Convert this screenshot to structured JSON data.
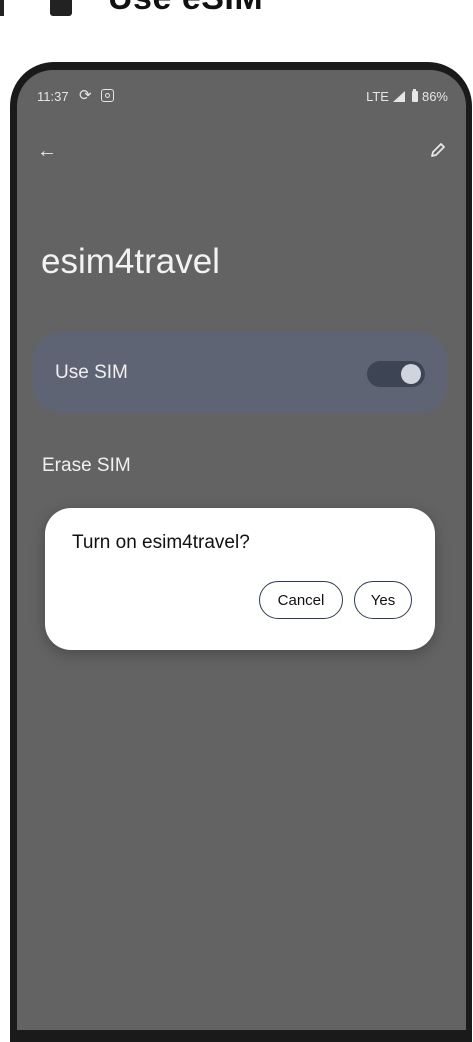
{
  "heading": {
    "text": "Use eSIM"
  },
  "status_bar": {
    "time": "11:37",
    "network": "LTE",
    "battery": "86%"
  },
  "page": {
    "title": "esim4travel"
  },
  "settings": {
    "use_sim": {
      "label": "Use SIM",
      "enabled": true
    },
    "erase_sim": {
      "label": "Erase SIM"
    }
  },
  "dialog": {
    "title": "Turn on esim4travel?",
    "cancel_label": "Cancel",
    "yes_label": "Yes"
  },
  "icons": {
    "sync": "sync-icon",
    "instagram": "instagram-icon",
    "signal": "signal-icon",
    "battery": "battery-icon",
    "back": "back-arrow-icon",
    "edit": "pencil-icon"
  },
  "colors": {
    "scrim": "#636363",
    "card": "#5f6475",
    "toggle_track": "#3d4555",
    "dialog_bg": "#ffffff",
    "button_border": "#2f3b55"
  }
}
